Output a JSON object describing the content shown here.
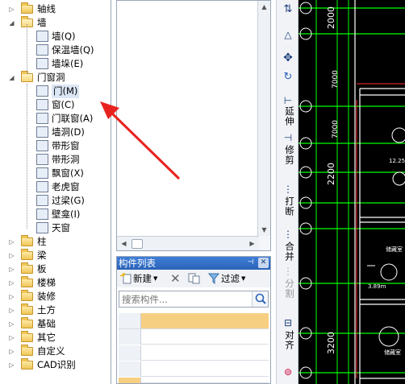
{
  "tree": [
    {
      "label": "轴线",
      "level": 0,
      "expanded": false,
      "type": "folder"
    },
    {
      "label": "墙",
      "level": 0,
      "expanded": true,
      "type": "folder"
    },
    {
      "label": "墙(Q)",
      "level": 1,
      "icon": "wall-icon"
    },
    {
      "label": "保温墙(Q)",
      "level": 1,
      "icon": "insulation-wall-icon"
    },
    {
      "label": "墙垛(E)",
      "level": 1,
      "icon": "wall-pier-icon"
    },
    {
      "label": "门窗洞",
      "level": 0,
      "expanded": true,
      "type": "folder"
    },
    {
      "label": "门(M)",
      "level": 1,
      "icon": "door-icon",
      "selected": true
    },
    {
      "label": "窗(C)",
      "level": 1,
      "icon": "window-icon"
    },
    {
      "label": "门联窗(A)",
      "level": 1,
      "icon": "door-window-icon"
    },
    {
      "label": "墙洞(D)",
      "level": 1,
      "icon": "wall-opening-icon"
    },
    {
      "label": "带形窗",
      "level": 1,
      "icon": "strip-window-icon"
    },
    {
      "label": "带形洞",
      "level": 1,
      "icon": "strip-opening-icon"
    },
    {
      "label": "飘窗(X)",
      "level": 1,
      "icon": "bay-window-icon"
    },
    {
      "label": "老虎窗",
      "level": 1,
      "icon": "dormer-icon"
    },
    {
      "label": "过梁(G)",
      "level": 1,
      "icon": "lintel-icon"
    },
    {
      "label": "壁龛(I)",
      "level": 1,
      "icon": "niche-icon"
    },
    {
      "label": "天窗",
      "level": 1,
      "icon": "skylight-icon"
    },
    {
      "label": "柱",
      "level": 0,
      "expanded": false,
      "type": "folder"
    },
    {
      "label": "梁",
      "level": 0,
      "expanded": false,
      "type": "folder"
    },
    {
      "label": "板",
      "level": 0,
      "expanded": false,
      "type": "folder"
    },
    {
      "label": "楼梯",
      "level": 0,
      "expanded": false,
      "type": "folder"
    },
    {
      "label": "装修",
      "level": 0,
      "expanded": false,
      "type": "folder"
    },
    {
      "label": "土方",
      "level": 0,
      "expanded": false,
      "type": "folder"
    },
    {
      "label": "基础",
      "level": 0,
      "expanded": false,
      "type": "folder"
    },
    {
      "label": "其它",
      "level": 0,
      "expanded": false,
      "type": "folder"
    },
    {
      "label": "自定义",
      "level": 0,
      "expanded": false,
      "type": "folder"
    },
    {
      "label": "CAD识别",
      "level": 0,
      "expanded": false,
      "type": "folder"
    }
  ],
  "component_list": {
    "title": "构件列表",
    "pin_icon": "pin-icon",
    "close_icon": "close-icon",
    "new_label": "新建",
    "filter_label": "过滤",
    "search_placeholder": "搜索构件..."
  },
  "vertical_toolbar": {
    "extend_label": "延伸",
    "trim_label": "修剪",
    "break_label": "打断",
    "merge_label": "合并",
    "split_label": "分割",
    "align_label": "对齐"
  },
  "cad": {
    "dimensions": [
      "2000",
      "7000",
      "2200",
      "2200",
      "2200",
      "7000",
      "3200"
    ],
    "dim_texts": [
      "2000",
      "7000",
      "2200",
      "3200"
    ],
    "room_labels": [
      "储藏室",
      "储藏室",
      "储藏室"
    ],
    "misc_labels": [
      "12.25",
      "3.89m"
    ],
    "colors": {
      "background": "#000000",
      "axis": "#00ff00",
      "wall": "#ffffff",
      "bubble": "#ffffff",
      "red": "#ff3030"
    }
  },
  "annotation": {
    "arrow_color": "#e8231f"
  }
}
